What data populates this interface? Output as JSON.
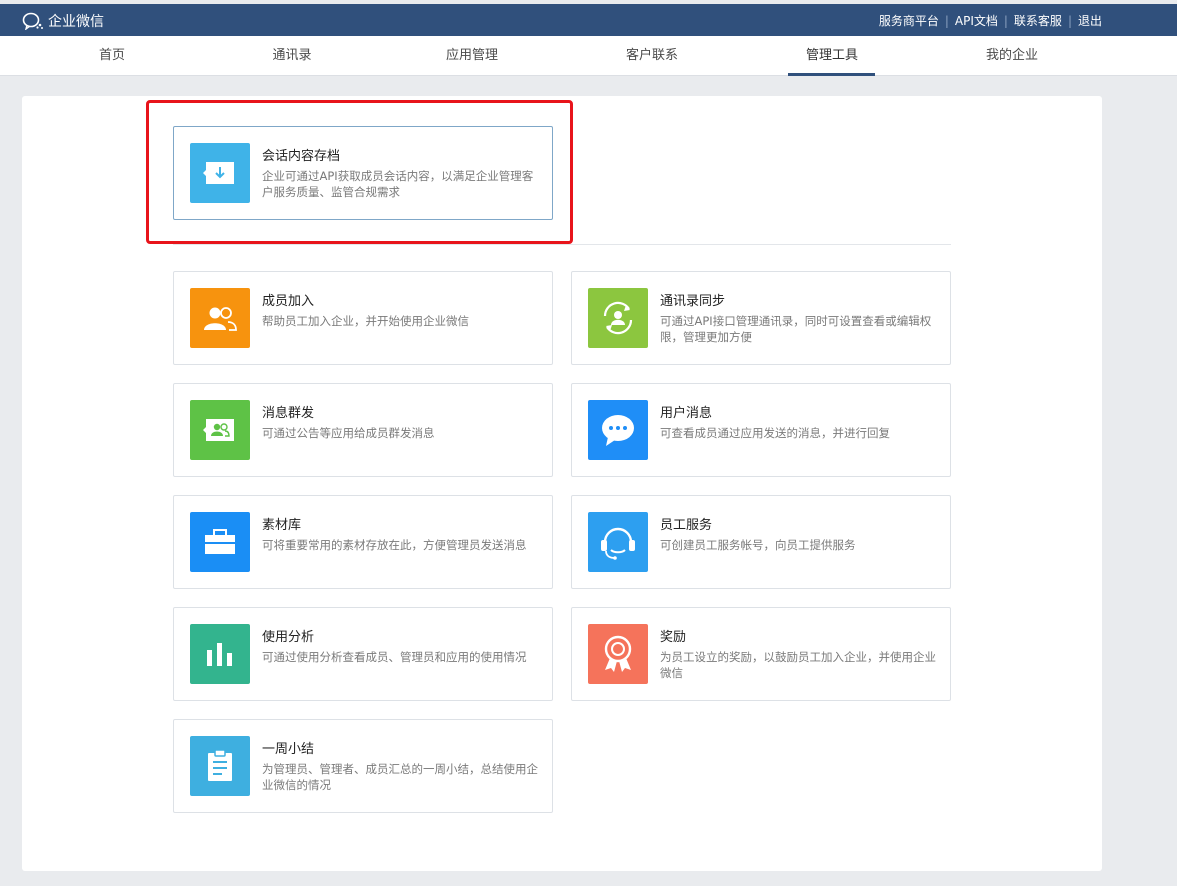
{
  "header": {
    "brand": "企业微信",
    "links": [
      "服务商平台",
      "API文档",
      "联系客服",
      "退出"
    ]
  },
  "nav": {
    "items": [
      "首页",
      "通讯录",
      "应用管理",
      "客户联系",
      "管理工具",
      "我的企业"
    ],
    "active": "管理工具"
  },
  "featured": {
    "title": "会话内容存档",
    "desc": "企业可通过API获取成员会话内容，以满足企业管理客户服务质量、监管合规需求",
    "icon": "archive-download-icon",
    "color": "#3fb3e8"
  },
  "tools": [
    {
      "title": "成员加入",
      "desc": "帮助员工加入企业，并开始使用企业微信",
      "icon": "members-join-icon",
      "color": "#f7930e"
    },
    {
      "title": "通讯录同步",
      "desc": "可通过API接口管理通讯录，同时可设置查看或编辑权限，管理更加方便",
      "icon": "contacts-sync-icon",
      "color": "#8cc63f"
    },
    {
      "title": "消息群发",
      "desc": "可通过公告等应用给成员群发消息",
      "icon": "broadcast-message-icon",
      "color": "#5ec246"
    },
    {
      "title": "用户消息",
      "desc": "可查看成员通过应用发送的消息，并进行回复",
      "icon": "chat-bubble-icon",
      "color": "#1f8ef7"
    },
    {
      "title": "素材库",
      "desc": "可将重要常用的素材存放在此，方便管理员发送消息",
      "icon": "briefcase-icon",
      "color": "#1a8ef5"
    },
    {
      "title": "员工服务",
      "desc": "可创建员工服务帐号，向员工提供服务",
      "icon": "headset-icon",
      "color": "#2d9ff0"
    },
    {
      "title": "使用分析",
      "desc": "可通过使用分析查看成员、管理员和应用的使用情况",
      "icon": "bar-chart-icon",
      "color": "#33b48e"
    },
    {
      "title": "奖励",
      "desc": "为员工设立的奖励，以鼓励员工加入企业，并使用企业微信",
      "icon": "award-medal-icon",
      "color": "#f5735b"
    },
    {
      "title": "一周小结",
      "desc": "为管理员、管理者、成员汇总的一周小结，总结使用企业微信的情况",
      "icon": "clipboard-icon",
      "color": "#3eafe0"
    }
  ]
}
